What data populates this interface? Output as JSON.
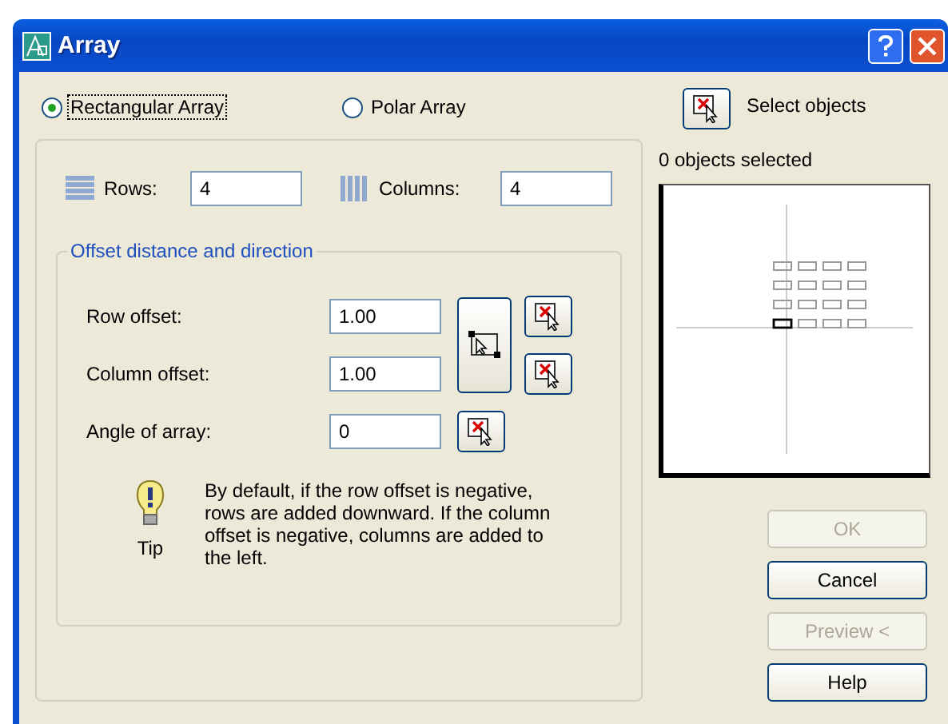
{
  "window": {
    "title": "Array"
  },
  "array_types": [
    {
      "label": "Rectangular Array",
      "selected": true,
      "focused": true
    },
    {
      "label": "Polar Array",
      "selected": false,
      "focused": false
    }
  ],
  "rows": {
    "label": "Rows:",
    "value": "4"
  },
  "columns": {
    "label": "Columns:",
    "value": "4"
  },
  "offset_group": {
    "title": "Offset distance and direction",
    "fields": [
      {
        "label": "Row offset:",
        "value": "1.00"
      },
      {
        "label": "Column offset:",
        "value": "1.00"
      },
      {
        "label": "Angle of array:",
        "value": "0"
      }
    ]
  },
  "tip": {
    "label": "Tip",
    "text": "By default, if the row offset is negative, rows are added downward.  If the column offset is negative, columns are added to the left."
  },
  "select_objects": {
    "label": "Select objects",
    "status": "0 objects selected"
  },
  "buttons": [
    {
      "label": "OK",
      "disabled": true
    },
    {
      "label": "Cancel",
      "disabled": false
    },
    {
      "label": "Preview <",
      "disabled": true
    },
    {
      "label": "Help",
      "disabled": false
    }
  ]
}
